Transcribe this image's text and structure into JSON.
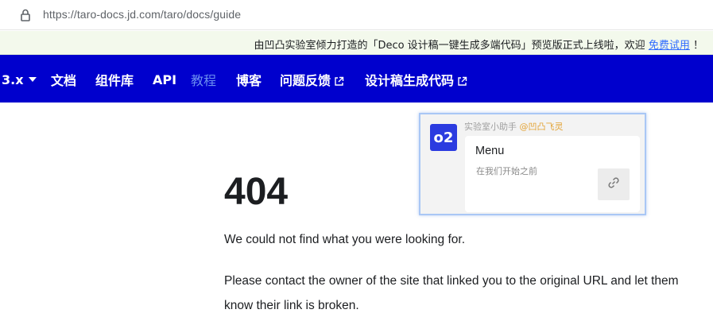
{
  "browser": {
    "url": "https://taro-docs.jd.com/taro/docs/guide",
    "icons": {
      "lock": "lock-icon"
    }
  },
  "announcement": {
    "text": "由凹凸实验室倾力打造的「Deco 设计稿一键生成多端代码」预览版正式上线啦，欢迎",
    "link_label": "免费试用",
    "trailing": "！",
    "colors": {
      "background": "#f3f9ec",
      "link": "#2f6bff"
    }
  },
  "navbar": {
    "background": "#0000cd",
    "items": [
      {
        "label": "3.x",
        "type": "version-dropdown"
      },
      {
        "label": "文档"
      },
      {
        "label": "组件库"
      },
      {
        "label": "API"
      },
      {
        "label": "教程",
        "active": true
      },
      {
        "label": "博客"
      },
      {
        "label": "问题反馈",
        "external": true
      },
      {
        "label": "设计稿生成代码",
        "external": true
      }
    ]
  },
  "main": {
    "title": "404",
    "paragraphs": [
      "We could not find what you were looking for.",
      "Please contact the owner of the site that linked you to the original URL and let them know their link is broken."
    ]
  },
  "popup": {
    "avatar_text": "o2",
    "sender": "实验室小助手",
    "mention": "@凹凸飞灵",
    "card_title": "Menu",
    "card_subtitle": "在我们开始之前",
    "icons": {
      "link": "link-icon"
    }
  }
}
